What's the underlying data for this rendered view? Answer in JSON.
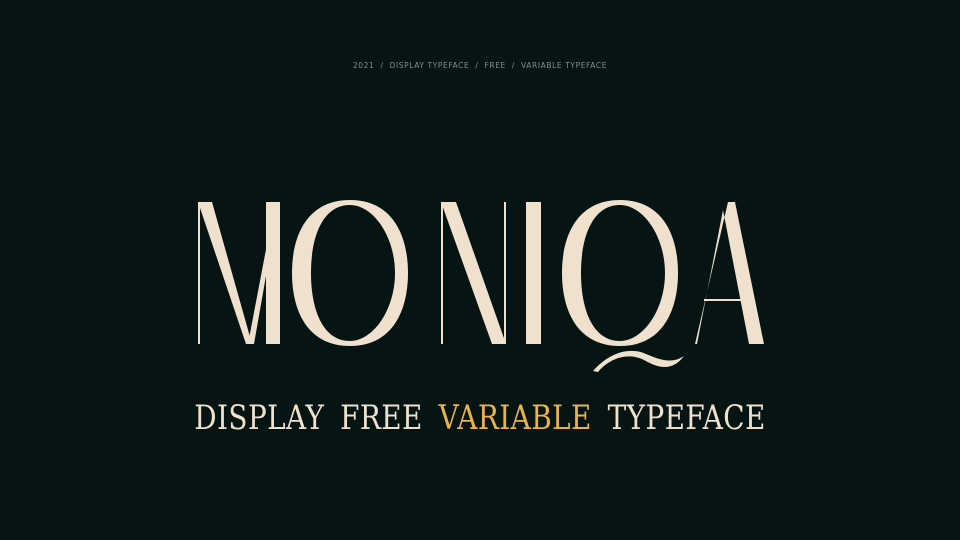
{
  "topline": {
    "items": [
      "2021",
      "DISPLAY TYPEFACE",
      "FREE",
      "VARIABLE TYPEFACE"
    ],
    "separator": "/"
  },
  "logo": {
    "text": "MONIQA",
    "color": "#efe1cd"
  },
  "tagline": {
    "word1": "DISPLAY",
    "word2": "FREE",
    "word3": "VARIABLE",
    "word4": "TYPEFACE",
    "accent_color": "#e9b24c"
  },
  "colors": {
    "background": "#061414",
    "text": "#efe1cd",
    "muted": "#8a8c86"
  }
}
